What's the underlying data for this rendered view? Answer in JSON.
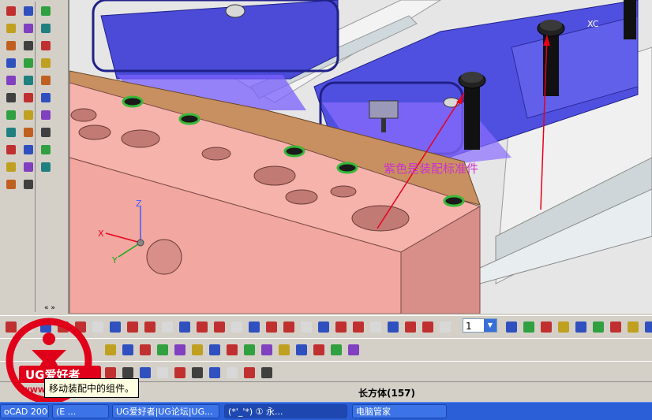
{
  "viewport": {
    "annotation": "紫色是装配标准件",
    "wcs_label": "XC",
    "axis_z": "Z",
    "axis_x": "X",
    "axis_y": "Y",
    "colors": {
      "pink_block": "#f2a7a0",
      "brown_plate": "#c89060",
      "purple": "#6a5cff",
      "arrow": "#e8001a",
      "text": "#cc33cc"
    }
  },
  "left_palette": {
    "icons": [
      "sketch-icon",
      "feature-icon",
      "curve-icon",
      "datum-icon",
      "block-icon",
      "cylinder-icon",
      "cone-icon",
      "sphere-icon",
      "boss-icon",
      "hole-icon",
      "pad-icon",
      "pocket-icon",
      "slot-icon",
      "groove-icon",
      "extrude-icon",
      "revolve-icon",
      "sweep-icon",
      "tube-icon",
      "unite-icon",
      "subtract-icon",
      "intersect-icon",
      "trim-icon",
      "split-icon",
      "mirror-icon",
      "edge-blend-icon",
      "chamfer-icon",
      "shell-icon",
      "draft-icon",
      "offset-icon",
      "scale-icon",
      "thread-icon",
      "pattern-icon"
    ],
    "more_label": "« »"
  },
  "toolbar1": {
    "layer_value": "1"
  },
  "status": {
    "selected_object": "长方体(157)",
    "tooltip": "移动装配中的组件。"
  },
  "watermark": {
    "brand": "UG爱好者",
    "url": "WWW.UGSNX.COM"
  },
  "taskbar": {
    "items": [
      "oCAD 2006",
      "(E ...",
      "UG爱好者|UG论坛|UG...",
      "(*'_'*)  ①  永...",
      "电脑管家"
    ]
  }
}
